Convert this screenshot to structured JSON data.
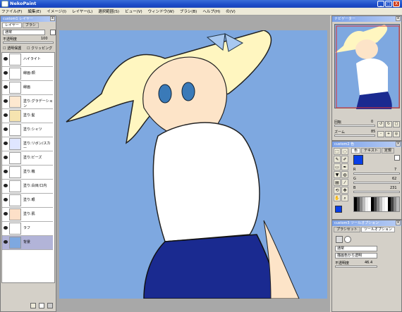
{
  "app": {
    "title": "NekoPaint",
    "controls": [
      "_",
      "□",
      "X"
    ]
  },
  "menu": [
    "ファイル(F)",
    "編集(E)",
    "イメージ(I)",
    "レイヤー(L)",
    "選択範囲(S)",
    "ビュー(V)",
    "ウィンドウ(W)",
    "ブラシ(B)",
    "ヘルプ(H)",
    "の(V)"
  ],
  "layer_panel": {
    "title": "custom1 レイヤー",
    "tabs": [
      "レイヤー",
      "ブラシ"
    ],
    "blend_mode": "通常",
    "opacity_label": "不透明度",
    "opacity_value": "100",
    "checks": [
      "透明保護",
      "クリッピング"
    ],
    "layers": [
      "ハイライト",
      "線画-顔",
      "線画",
      "塗り:グラデーション",
      "塗り:髪",
      "塗り:シャツ",
      "塗り:リボン/スカー",
      "塗り:ビーズ",
      "塗り:機",
      "塗り:白目/口内",
      "塗り:眼",
      "塗り:肌",
      "ラフ",
      "背景"
    ],
    "selected_index": 13
  },
  "navigator": {
    "title": "ナビゲーター",
    "rotate_label": "回転",
    "rotate_value": "0",
    "zoom_label": "ズーム",
    "zoom_value": "85"
  },
  "color": {
    "title": "custom2 色",
    "tabs": [
      "色",
      "テキスト",
      "定規"
    ],
    "r_label": "R",
    "r_value": "7",
    "g_label": "G",
    "g_value": "62",
    "b_label": "B",
    "b_value": "231",
    "current_color": "#073ee7"
  },
  "tool_options": {
    "title": "custom3 ツールオプション",
    "tabs": [
      "プラシセット",
      "ツールオプション"
    ],
    "mode": "通常",
    "sample": "描画色から透明",
    "opacity_label": "不透明度",
    "opacity_value": "46.4"
  },
  "colors": {
    "titlebar": "#1c4cc8",
    "canvas_bg": "#7ea8e0",
    "selected_layer": "#b2b4d8"
  }
}
